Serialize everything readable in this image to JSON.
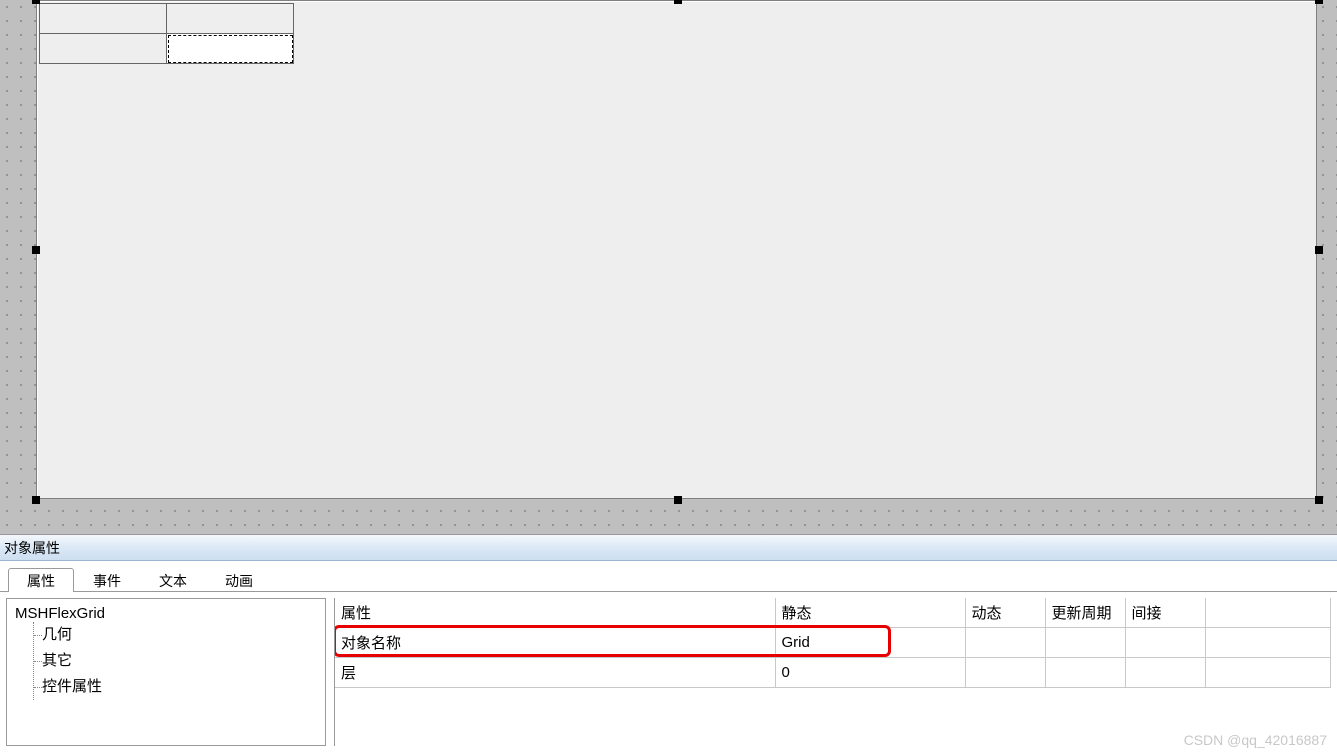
{
  "panel": {
    "title": "对象属性",
    "tabs": [
      {
        "label": "属性",
        "active": true
      },
      {
        "label": "事件",
        "active": false
      },
      {
        "label": "文本",
        "active": false
      },
      {
        "label": "动画",
        "active": false
      }
    ]
  },
  "tree": {
    "root": "MSHFlexGrid",
    "children": [
      "几何",
      "其它",
      "控件属性"
    ]
  },
  "grid": {
    "headers": {
      "name": "属性",
      "static": "静态",
      "dynamic": "动态",
      "cycle": "更新周期",
      "indirect": "间接"
    },
    "rows": [
      {
        "name": "对象名称",
        "static": "Grid",
        "dynamic": "",
        "cycle": "",
        "indirect": "",
        "highlight": true
      },
      {
        "name": "层",
        "static": "0",
        "dynamic": "",
        "cycle": "",
        "indirect": "",
        "highlight": false
      }
    ]
  },
  "watermark": "CSDN @qq_42016887"
}
